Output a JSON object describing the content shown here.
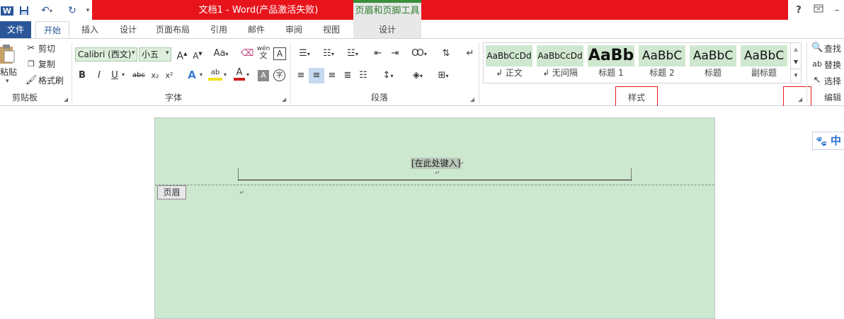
{
  "titlebar": {
    "app_icon": "W",
    "qat_icons": [
      "save-icon",
      "undo-icon",
      "redo-icon",
      "customize-qat-icon"
    ],
    "doc_title": "文档1 - Word(产品激活失败)",
    "context_group": "页眉和页脚工具",
    "context_tab": "设计",
    "help": "?",
    "restore_icon": "ribbon-display-icon",
    "minimize": "–"
  },
  "tabs": {
    "file": "文件",
    "items": [
      "开始",
      "插入",
      "设计",
      "页面布局",
      "引用",
      "邮件",
      "审阅",
      "视图"
    ]
  },
  "clipboard": {
    "paste": "粘贴",
    "cut": "剪切",
    "copy": "复制",
    "format_painter": "格式刷",
    "label": "剪贴板"
  },
  "font": {
    "name": "Calibri (西文)",
    "size": "小五",
    "grow": "A",
    "shrink": "A",
    "case": "Aa",
    "wen": "wén",
    "wen_char": "文",
    "bordered_a": "A",
    "bold": "B",
    "italic": "I",
    "underline": "U",
    "strike": "abc",
    "sub": "x₂",
    "sup": "x²",
    "effects": "A",
    "highlight": "ab",
    "color": "A",
    "shading": "A",
    "circle": "字",
    "label": "字体"
  },
  "paragraph": {
    "label": "段落"
  },
  "styles": {
    "items": [
      {
        "preview": "AaBbCcDd",
        "name": "↲ 正文"
      },
      {
        "preview": "AaBbCcDd",
        "name": "↲ 无间隔"
      },
      {
        "preview": "AaBb",
        "name": "标题 1"
      },
      {
        "preview": "AaBbC",
        "name": "标题 2"
      },
      {
        "preview": "AaBbC",
        "name": "标题"
      },
      {
        "preview": "AaBbC",
        "name": "副标题"
      }
    ],
    "label": "样式"
  },
  "editing": {
    "find": "查找",
    "replace": "替换",
    "select": "选择",
    "label": "编辑"
  },
  "document": {
    "placeholder": "[在此处键入]",
    "header_label": "页眉",
    "para_mark": "↵"
  },
  "ime": {
    "text": "中"
  },
  "colors": {
    "title_red": "#e8141c",
    "word_blue": "#2b579a",
    "page_green": "#cce8cf",
    "highlight_red_box": "#e0191f"
  }
}
